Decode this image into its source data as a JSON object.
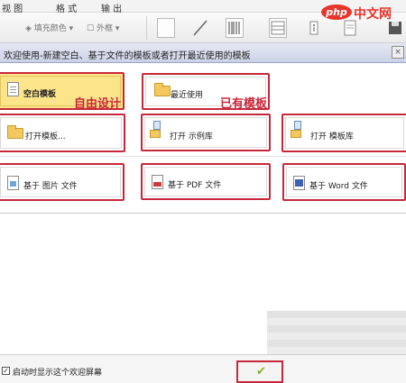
{
  "menu": {
    "view": "视 图",
    "format": "格 式",
    "output": "输 出"
  },
  "toolbar": {
    "fill_color": "填充颜色",
    "border": "外框"
  },
  "dialog": {
    "title": "欢迎使用-新建空白、基于文件的模板或者打开最近使用的模板",
    "close_label": "×"
  },
  "options": {
    "blank_template": "空白模板",
    "recent": "最近使用",
    "open_template": "打开模板...",
    "open_sample": "打开 示例库",
    "open_library": "打开 模板库",
    "from_image": "基于 图片 文件",
    "from_pdf": "基于 PDF 文件",
    "from_word": "基于 Word 文件"
  },
  "annotations": {
    "free_design": "自由设计",
    "existing_template": "已有模板"
  },
  "footer": {
    "show_on_startup": "启动时显示这个欢迎屏幕",
    "checkbox_mark": "✓",
    "ok_mark": "✔"
  },
  "watermark": {
    "logo": "php",
    "site": "中文网"
  }
}
